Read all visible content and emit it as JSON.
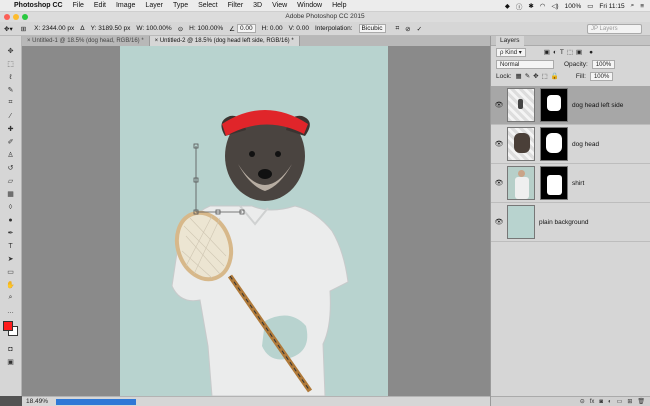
{
  "menubar": {
    "apple": "",
    "items": [
      "Photoshop CC",
      "File",
      "Edit",
      "Image",
      "Layer",
      "Type",
      "Select",
      "Filter",
      "3D",
      "View",
      "Window",
      "Help"
    ],
    "battery": "100%",
    "clock": "Fri 11:15"
  },
  "window": {
    "title": "Adobe Photoshop CC 2015"
  },
  "options": {
    "x": "X: 2344.00 px",
    "y": "Y: 3189.50 px",
    "w": "W: 100.00%",
    "h": "H: 100.00%",
    "angle": "0.00",
    "h_skew": "H: 0.00",
    "v_skew": "V: 0.00",
    "interp_label": "Interpolation:",
    "interp_value": "Bicubic",
    "search_placeholder": "JP Layers"
  },
  "tabs": [
    {
      "label": "Untitled-1 @ 18.5% (dog head, RGB/16) *"
    },
    {
      "label": "Untitled-2 @ 18.5% (dog head left side, RGB/16) *"
    }
  ],
  "status": {
    "zoom": "18.49%"
  },
  "colors": {
    "foreground": "#ff1c1c",
    "background": "#ffffff",
    "artboard": "#b8d3cf"
  },
  "panel": {
    "title": "Layers",
    "kind_label": "Kind",
    "blend_mode": "Normal",
    "opacity_label": "Opacity:",
    "opacity_value": "100%",
    "lock_label": "Lock:",
    "fill_label": "Fill:",
    "fill_value": "100%",
    "layers": [
      {
        "name": "dog head left side"
      },
      {
        "name": "dog head"
      },
      {
        "name": "shirt"
      },
      {
        "name": "plain background"
      }
    ],
    "footer_fx": "fx"
  }
}
